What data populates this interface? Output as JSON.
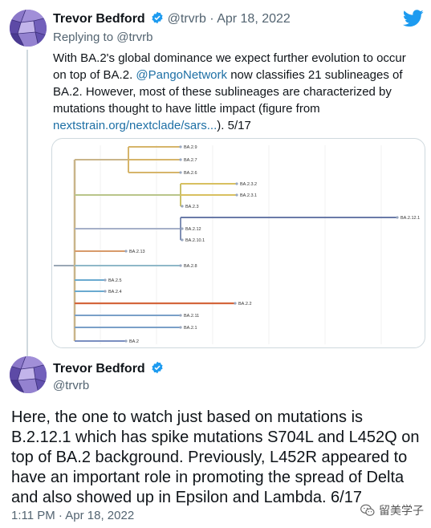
{
  "tweet1": {
    "name": "Trevor Bedford",
    "handle": "@trvrb",
    "separator": "·",
    "date": "Apr 18, 2022",
    "replying_to": "Replying to @trvrb",
    "text_1": "With BA.2's global dominance we expect further evolution to occur on top of BA.2. ",
    "mention": "@PangoNetwork",
    "text_2": " now classifies 21 sublineages of BA.2. However, most of these sublineages are characterized by mutations thought to have little impact (figure from ",
    "link": "nextstrain.org/nextclade/sars...",
    "text_3": "). 5/17"
  },
  "figure": {
    "clades": [
      "BA.2.9",
      "BA.2.7",
      "BA.2.6",
      "BA.2.3.2",
      "BA.2.3.1",
      "BA.2.3",
      "BA.2.12.1",
      "BA.2.12",
      "BA.2.10.1",
      "BA.2.13",
      "BA.2.8",
      "BA.2.5",
      "BA.2.4",
      "BA.2.2",
      "BA.2.11",
      "BA.2.1",
      "BA.2"
    ]
  },
  "tweet2": {
    "name": "Trevor Bedford",
    "handle": "@trvrb",
    "text": "Here, the one to watch just based on mutations is B.2.12.1 which has spike mutations S704L and L452Q on top of BA.2 background. Previously, L452R appeared to have an important role in promoting the spread of Delta and also showed up in Epsilon and Lambda. 6/17",
    "time": "1:11 PM",
    "separator": "·",
    "date": "Apr 18, 2022"
  },
  "watermark": {
    "text": "留美学子"
  },
  "icons": [
    "twitter-bird-icon",
    "verified-badge-icon",
    "avatar",
    "wechat-icon"
  ],
  "colors": {
    "link": "#1d6fa5",
    "verified": "#1d9bf0",
    "muted": "#536471"
  }
}
